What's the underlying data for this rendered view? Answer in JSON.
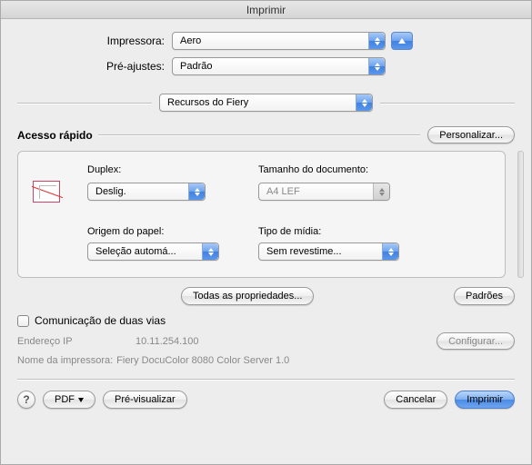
{
  "title": "Imprimir",
  "labels": {
    "printer": "Impressora:",
    "presets": "Pré-ajustes:"
  },
  "printer": {
    "value": "Aero"
  },
  "presets": {
    "value": "Padrão"
  },
  "section": {
    "value": "Recursos do Fiery"
  },
  "quickaccess": {
    "title": "Acesso rápido",
    "customize": "Personalizar...",
    "duplex_label": "Duplex:",
    "duplex_value": "Deslig.",
    "docsize_label": "Tamanho do documento:",
    "docsize_value": "A4 LEF",
    "papersource_label": "Origem do papel:",
    "papersource_value": "Seleção automá...",
    "mediatype_label": "Tipo de mídia:",
    "mediatype_value": "Sem revestime..."
  },
  "buttons": {
    "all_props": "Todas as propriedades...",
    "defaults": "Padrões",
    "configure": "Configurar...",
    "pdf": "PDF",
    "preview": "Pré-visualizar",
    "cancel": "Cancelar",
    "print": "Imprimir"
  },
  "two_way": {
    "label": "Comunicação de duas vias",
    "ip_label": "Endereço IP",
    "ip_value": "10.11.254.100",
    "printer_name_label": "Nome da impressora:",
    "printer_name_value": "Fiery DocuColor 8080 Color Server 1.0"
  },
  "help_glyph": "?"
}
